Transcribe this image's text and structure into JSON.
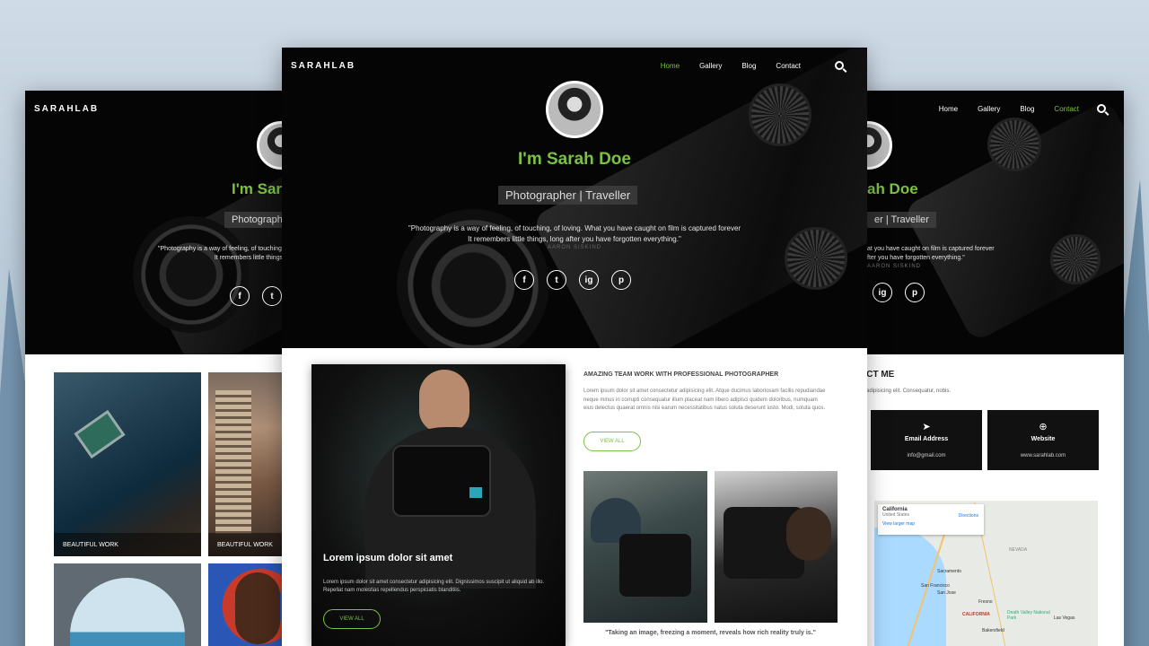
{
  "brand": "SARAHLAB",
  "nav": {
    "home": "Home",
    "gallery": "Gallery",
    "blog": "Blog",
    "contact": "Contact"
  },
  "hero": {
    "name": "I'm Sarah Doe",
    "name_left": "I'm Sar",
    "name_right": "ah Doe",
    "subtitle": "Photographer | Traveller",
    "subtitle_left": "Photograph",
    "subtitle_right": "er | Traveller",
    "quote_line1": "\"Photography is a way of feeling, of touching, of loving. What you have caught on film is captured forever",
    "quote_line2": "It remembers little things, long after you have forgotten everything.\"",
    "quote_left_line1": "\"Photography is a way of feeling, of touching, of lovin",
    "quote_left_line2": "It remembers little things, long af",
    "quote_right_line1": "at you have caught on film is captured forever",
    "quote_right_line2": "fter you have forgotten everything.\"",
    "quote_author": "AARON SISKIND",
    "social": [
      "f",
      "t",
      "ig",
      "p"
    ]
  },
  "gallery": {
    "caption1": "BEAUTIFUL WORK",
    "caption2": "BEAUTIFUL WORK"
  },
  "feature": {
    "card_title": "Lorem ipsum dolor sit amet",
    "card_text": "Lorem ipsum dolor sit amet consectetur adipisicing elit. Dignissimos suscipit ut aliquid ab illo. Repellat nam molestias repellendus perspiciatis blanditiis.",
    "card_button": "VIEW ALL",
    "heading": "AMAZING TEAM WORK WITH PROFESSIONAL PHOTOGRAPHER",
    "paragraph": "Lorem ipsum dolor sit amet consectetur adipisicing elit. Atque ducimus laboriosam facilis repudiandae neque minus in corrupti consequatur illum placeat nam libero adipisci quidem doloribus, numquam eius delectus quaerat omnis nisi earum necessitatibus natus soluta deserunt iusto. Modi, soluta quos.",
    "button": "VIEW ALL",
    "caption_quote": "\"Taking an image, freezing a moment, reveals how rich reality truly is.\""
  },
  "contact": {
    "heading": "ACT ME",
    "text": "ur adipisicing elit. Consequatur, nobis.",
    "email_title": "Email Address",
    "email_value": "info@gmail.com",
    "website_title": "Website",
    "website_value": "www.sarahlab.com"
  },
  "map": {
    "box_title": "California",
    "box_sub": "United States",
    "box_dir": "Directions",
    "box_link": "View larger map",
    "labels": [
      "NEVADA",
      "Sacramento",
      "San Francisco",
      "San Jose",
      "Fresno",
      "CALIFORNIA",
      "Death Valley National Park",
      "Las Vegas",
      "Bakersfield"
    ]
  },
  "colors": {
    "accent": "#7bc142",
    "hero_bg": "#050505"
  }
}
